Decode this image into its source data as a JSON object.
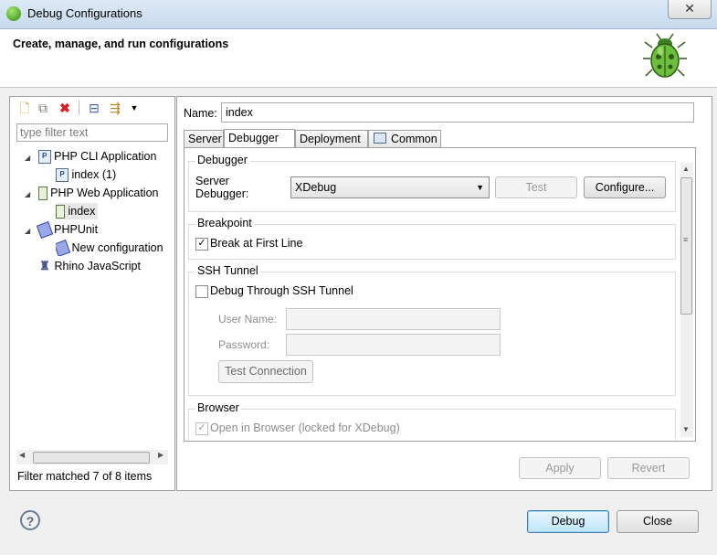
{
  "window": {
    "title": "Debug Configurations",
    "close_glyph": "✕"
  },
  "header": {
    "title": "Create, manage, and run configurations",
    "icon": "bug-icon"
  },
  "left": {
    "toolbar": [
      "new-config-icon",
      "duplicate-icon",
      "delete-icon",
      "collapse-all-icon",
      "filter-icon",
      "dropdown-arrow-icon"
    ],
    "filter_placeholder": "type filter text",
    "tree": [
      {
        "label": "PHP CLI Application",
        "icon_text": "P",
        "expanded": true
      },
      {
        "label": "index (1)",
        "icon_text": "P"
      },
      {
        "label": "PHP Web Application",
        "icon_text": "",
        "expanded": true
      },
      {
        "label": "index",
        "icon_text": "",
        "selected": true
      },
      {
        "label": "PHPUnit",
        "icon_text": "",
        "expanded": true
      },
      {
        "label": "New configuration",
        "icon_text": ""
      },
      {
        "label": "Rhino JavaScript",
        "icon_text": ""
      }
    ],
    "filter_status": "Filter matched 7 of 8 items"
  },
  "right": {
    "name_label": "Name:",
    "name_value": "index",
    "tabs": [
      "Server",
      "Debugger",
      "Deployment",
      "Common"
    ],
    "active_tab": "Debugger",
    "debugger_group": {
      "title": "Debugger",
      "label_line1": "Server",
      "label_line2": "Debugger:",
      "selected": "XDebug",
      "test_button": "Test",
      "configure_button": "Configure..."
    },
    "breakpoint_group": {
      "title": "Breakpoint",
      "checkbox_label": "Break at First Line",
      "checked": true
    },
    "ssh_group": {
      "title": "SSH Tunnel",
      "checkbox_label": "Debug Through SSH Tunnel",
      "checked": false,
      "user_label": "User Name:",
      "password_label": "Password:",
      "test_button": "Test Connection"
    },
    "browser_group": {
      "title": "Browser",
      "checkbox_label": "Open in Browser (locked for XDebug)",
      "checked": true
    },
    "apply_button": "Apply",
    "revert_button": "Revert"
  },
  "footer": {
    "help_glyph": "?",
    "debug_button": "Debug",
    "close_button": "Close"
  },
  "colors": {
    "accent": "#3c7fb1",
    "delete_red": "#d22020"
  }
}
